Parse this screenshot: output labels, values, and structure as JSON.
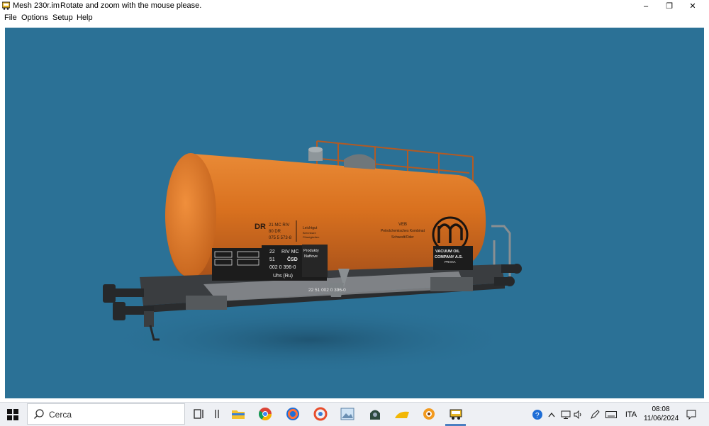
{
  "window": {
    "app_name": "Mesh 230r.im",
    "message": "Rotate and zoom with the mouse please.",
    "controls": {
      "minimize": "–",
      "restore": "❐",
      "close": "✕"
    }
  },
  "menu": {
    "items": [
      "File",
      "Options",
      "Setup",
      "Help"
    ]
  },
  "viewport": {
    "background": "#2b7196",
    "wagon": {
      "tank_color": "#d9711f",
      "tank_left_label": [
        "DR",
        "21 MC RIV",
        "80 DR",
        "075 5 573-8"
      ],
      "tank_small_label": [
        "Leichtgut",
        "Brennbare",
        "Flüssigkeiten"
      ],
      "tank_right_label": [
        "VEB",
        "Petrolchemisches Kombinat",
        "Schwedt/Oder"
      ],
      "plate_center": [
        "22",
        "RIV MC",
        "51",
        "ČSD",
        "002 0 396-0",
        "Uhs (Ru)"
      ],
      "plate_products": [
        "Produkty",
        "Naftove"
      ],
      "plate_vacuum": [
        "VACUUM OIL",
        "COMPANY A.S.",
        "PRAHA"
      ],
      "frame_number": "22 51 002 0 396-0"
    }
  },
  "taskbar": {
    "search_placeholder": "Cerca",
    "icons": [
      "task-view-icon",
      "file-explorer-icon",
      "chrome-icon",
      "firefox-icon",
      "app-icon-1",
      "image-viewer-icon",
      "app-icon-2",
      "app-icon-3",
      "app-icon-4",
      "mesh-viewer-icon"
    ],
    "tray": {
      "language": "ITA",
      "time": "08:08",
      "date": "11/06/2024"
    }
  }
}
